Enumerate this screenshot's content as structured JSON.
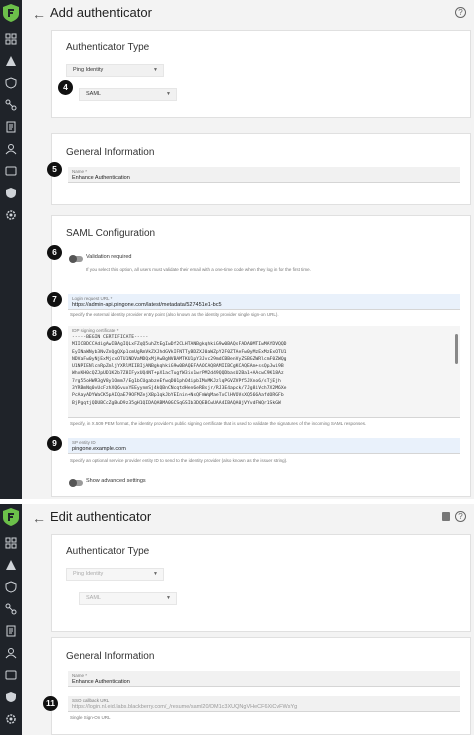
{
  "add_screen": {
    "title": "Add authenticator",
    "authenticator_type": {
      "heading": "Authenticator Type",
      "provider_select": "Ping Identity",
      "protocol_select": "SAML"
    },
    "general": {
      "heading": "General Information",
      "name_label": "Name *",
      "name_value": "Enhance Authentication"
    },
    "saml": {
      "heading": "SAML Configuration",
      "validation_label": "Validation required",
      "validation_help": "If you select this option, all users must validate their email with a one-time code when they log in for the first time.",
      "login_url_label": "Login request URL *",
      "login_url_value": "https://admin-api.pingone.com/latest/metadata/527451e1-bc5",
      "login_url_help": "Specify the external identity provider entry point (also known as the identity provider single sign-on URL).",
      "cert_label": "IDP signing certificate *",
      "cert_lines": [
        "-----BEGIN CERTIFICATE-----",
        "MIICBDCCAdigAwIBAgIQLxFZqQ5uhZtEgIwDf2CLHTANBgkqhkiG9w0BAQsFADA0MTIwMAYDVQQD",
        "EyINaWNyb3NvZnQgQXp1cmUgRmVkZXJhdGVkIFNTTyBDZXJ0aWZpY2F0ZTAeFw0yMzExMzExOTU1",
        "NDVaFw0yNjExMjcxOTU1NDVaMDQxMjAwBgNVBAMTKU1pY3Jvc29mdCBBenVyZSBGZWRlcmF0ZWQg",
        "U1NPIENlcnRpZmljYXRlMIIBIjANBgkqhkiG9w0BAQEFAAOCAQ8AMIIBCgKCAQEAm+ssQpJwi9B",
        "WhxKH0cQZJpUD1K2b7Z8IFyxUQ4NT+pX1acTugfW3ix1wrPM2d49QQDbasU2Ba1+AAcwC9K18Az",
        "7rg55oHWR3gV8y1Omm7/Eg1bCUgabzeEfwqD01phO4ipbIMxMKJzlqPGVZVPf5JXno6/sTjEjh",
        "3YRBmNq0vUcFzhXQ6vuxYEEyynmSj4kQBnCNcqtdHen6eRBsjr/RJ3E4apck/7Jg8iVch7X2M6Xe",
        "PcAayADYWaCK5pAIQaE79OFMZejXBp1qkJbYEInin+NsQFmWqMaeTxClHVOVsXQ566AafdORGFb",
        "BjPgqtjQDUBCcZgBuD9z35gH1QIDAQABMA0GCSqGSIb3DQEBCwUAA4IBAQA0jVYvdFWQr1SkGW"
      ],
      "cert_help": "Specify, in X.509 PEM format, the identity provider's public signing certificate that is used to validate the signatures of the incoming SAML responses.",
      "sp_label": "SP entity ID",
      "sp_value": "pingone.example.com",
      "sp_help": "Specify an optional service provider entity ID to send to the identity provider (also known as the issuer string).",
      "advanced_label": "Show advanced settings"
    }
  },
  "edit_screen": {
    "title": "Edit authenticator",
    "authenticator_type": {
      "heading": "Authenticator Type",
      "provider_select": "Ping Identity",
      "protocol_select": "SAML"
    },
    "general": {
      "heading": "General Information",
      "name_label": "Name *",
      "name_value": "Enhance Authentication",
      "sso_label": "SSO callback URL",
      "sso_value": "https://login.nl.eid.labs.blackberry.com/_/resume/saml20/DM1c3XUQNgVHeCF6XiCvFWsYg",
      "sso_help": "Single Sign-On URL"
    }
  },
  "callouts": [
    "4",
    "5",
    "6",
    "7",
    "8",
    "9",
    "11"
  ],
  "icons": {
    "back": "←",
    "help": "?"
  },
  "colors": {
    "sidebar": "#1f2329",
    "brand_green": "#6cc04a",
    "field_highlight": "#e9f1fb",
    "callout": "#111111"
  }
}
